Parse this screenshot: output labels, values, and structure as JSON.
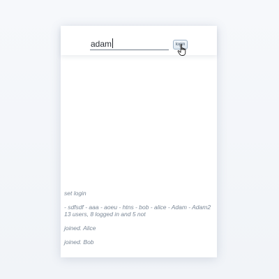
{
  "login": {
    "username_value": "adam",
    "button_label": "login"
  },
  "log": {
    "set_login": "set login",
    "user_list": "- sdfsdf - aaa - aoeu - htns - bob - alice - Adam - Adam2",
    "user_summary": "13 users, 8 logged in and 5 not",
    "joined_alice": "joined. Alice",
    "joined_bob": "joined. Bob"
  }
}
